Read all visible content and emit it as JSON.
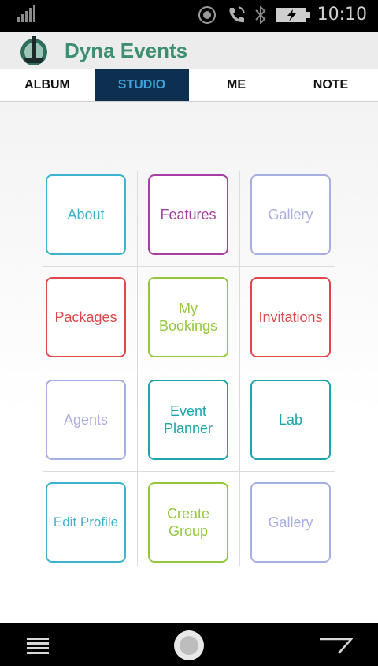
{
  "status": {
    "time": "10:10"
  },
  "app": {
    "title": "Dyna Events",
    "accent": "#3e8f71"
  },
  "tabs": [
    {
      "label": "ALBUM",
      "active": false
    },
    {
      "label": "STUDIO",
      "active": true
    },
    {
      "label": "ME",
      "active": false
    },
    {
      "label": "NOTE",
      "active": false
    }
  ],
  "colors": {
    "tab_active_bg": "#0d3050",
    "tab_active_text": "#3ea1d9"
  },
  "tiles": [
    {
      "label": "About",
      "color": "#3db3cf"
    },
    {
      "label": "Features",
      "color": "#a63ea6"
    },
    {
      "label": "Gallery",
      "color": "#a8aee0"
    },
    {
      "label": "Packages",
      "color": "#e0474c"
    },
    {
      "label": "My Bookings",
      "color": "#93c83c"
    },
    {
      "label": "Invitations",
      "color": "#e0474c"
    },
    {
      "label": "Agents",
      "color": "#a8aee0"
    },
    {
      "label": "Event Planner",
      "color": "#1ea5aa"
    },
    {
      "label": "Lab",
      "color": "#1ea5aa"
    },
    {
      "label": "Edit Profile",
      "color": "#3db3cf"
    },
    {
      "label": "Create Group",
      "color": "#93c83c"
    },
    {
      "label": "Gallery",
      "color": "#a8aee0"
    }
  ]
}
